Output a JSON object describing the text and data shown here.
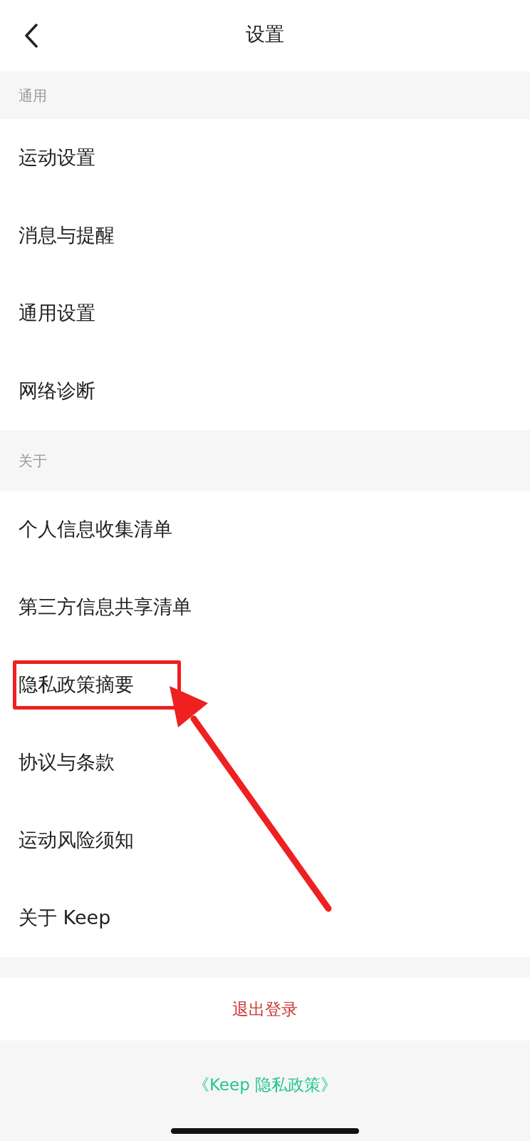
{
  "header": {
    "title": "设置"
  },
  "sections": [
    {
      "label": "通用",
      "items": [
        "运动设置",
        "消息与提醒",
        "通用设置",
        "网络诊断"
      ]
    },
    {
      "label": "关于",
      "items": [
        "个人信息收集清单",
        "第三方信息共享清单",
        "隐私政策摘要",
        "协议与条款",
        "运动风险须知",
        "关于 Keep"
      ]
    }
  ],
  "logout": "退出登录",
  "footer_link": "《Keep 隐私政策》"
}
